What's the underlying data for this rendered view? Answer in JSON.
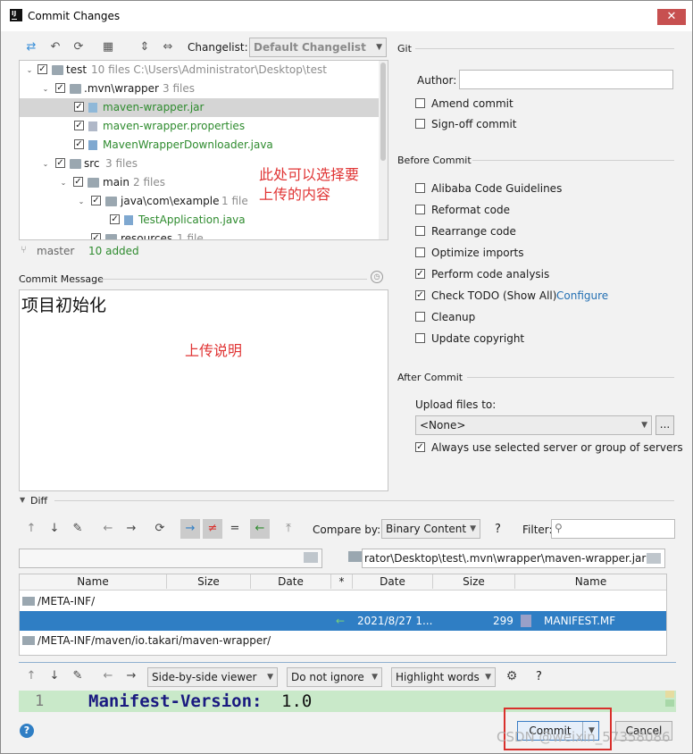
{
  "window": {
    "title": "Commit Changes",
    "app_icon": "IJ",
    "close_glyph": "✕"
  },
  "toolbar": {
    "icons": [
      "move-icon",
      "undo-icon",
      "refresh-icon",
      "group-icon",
      "expand-all-icon",
      "collapse-all-icon"
    ],
    "changelist_label": "Changelist:",
    "changelist_value": "Default Changelist"
  },
  "tree": {
    "rows": [
      {
        "name": "test",
        "meta": "10 files  C:\\Users\\Administrator\\Desktop\\test",
        "kind": "folder"
      },
      {
        "name": ".mvn\\wrapper",
        "meta": "3 files",
        "kind": "folder"
      },
      {
        "name": "maven-wrapper.jar",
        "meta": "",
        "kind": "jar"
      },
      {
        "name": "maven-wrapper.properties",
        "meta": "",
        "kind": "props"
      },
      {
        "name": "MavenWrapperDownloader.java",
        "meta": "",
        "kind": "java"
      },
      {
        "name": "src",
        "meta": "3 files",
        "kind": "folder"
      },
      {
        "name": "main",
        "meta": "2 files",
        "kind": "folder"
      },
      {
        "name": "java\\com\\example",
        "meta": "1 file",
        "kind": "folder"
      },
      {
        "name": "TestApplication.java",
        "meta": "",
        "kind": "java"
      },
      {
        "name": "resources",
        "meta": "1 file",
        "kind": "folder"
      }
    ],
    "annotation_line1": "此处可以选择要",
    "annotation_line2": "上传的内容"
  },
  "status": {
    "branch": "master",
    "added": "10 added"
  },
  "commit_message": {
    "label": "Commit Message",
    "value": "项目初始化",
    "annotation": "上传说明"
  },
  "git": {
    "section": "Git",
    "author_label": "Author:",
    "author_value": "",
    "amend": "Amend commit",
    "signoff": "Sign-off commit"
  },
  "before_commit": {
    "section": "Before Commit",
    "options": [
      {
        "label": "Alibaba Code Guidelines",
        "checked": false
      },
      {
        "label": "Reformat code",
        "checked": false
      },
      {
        "label": "Rearrange code",
        "checked": false
      },
      {
        "label": "Optimize imports",
        "checked": false
      },
      {
        "label": "Perform code analysis",
        "checked": true
      },
      {
        "label": "Check TODO (Show All)",
        "checked": true,
        "link": "Configure"
      },
      {
        "label": "Cleanup",
        "checked": false
      },
      {
        "label": "Update copyright",
        "checked": false
      }
    ]
  },
  "after_commit": {
    "section": "After Commit",
    "upload_label": "Upload files to:",
    "upload_value": "<None>",
    "browse": "...",
    "always_use": "Always use selected server or group of servers"
  },
  "diff": {
    "section": "Diff",
    "compare_label": "Compare by:",
    "compare_value": "Binary Content",
    "help": "?",
    "filter_label": "Filter:",
    "filter_value": "",
    "path_right": "rator\\Desktop\\test\\.mvn\\wrapper\\maven-wrapper.jar",
    "columns_left": [
      "Name",
      "Size",
      "Date",
      "*"
    ],
    "columns_right": [
      "Date",
      "Size",
      "Name"
    ],
    "rows": [
      {
        "path": "/META-INF/"
      },
      {
        "date": "2021/8/27 1...",
        "size": "299",
        "name": "MANIFEST.MF"
      },
      {
        "path": "/META-INF/maven/io.takari/maven-wrapper/"
      }
    ],
    "viewer_value": "Side-by-side viewer",
    "ignore_value": "Do not ignore",
    "highlight_value": "Highlight words",
    "line_number": "1",
    "code_key": "Manifest-Version:",
    "code_value": "1.0"
  },
  "footer": {
    "help": "?",
    "commit": "Commit",
    "cancel": "Cancel",
    "watermark": "CSDN @weixin_57358086"
  },
  "colors": {
    "accent": "#2470b3",
    "selection": "#2f7ec4",
    "annotation": "#e03434",
    "highlight_box": "#d9302c"
  }
}
